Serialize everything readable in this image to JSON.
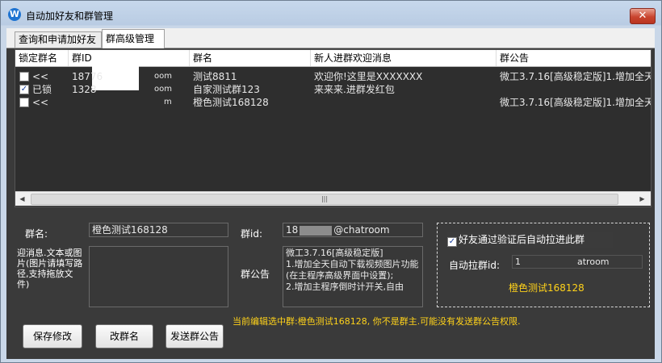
{
  "window": {
    "title": "自动加好友和群管理",
    "icon_letter": "W",
    "close_symbol": "✕"
  },
  "tabs": [
    {
      "label": "查询和申请加好友"
    },
    {
      "label": "群高级管理"
    }
  ],
  "table": {
    "columns": [
      "锁定群名",
      "群ID",
      "群名",
      "新人进群欢迎消息",
      "群公告"
    ],
    "rows": [
      {
        "checked": false,
        "lock": "<<",
        "group_id": "18776",
        "group_id_tail": "oom",
        "group_name": "测试8811",
        "welcome": "欢迎你!这里是XXXXXXX",
        "notice": "微工3.7.16[高级稳定版]1.增加全天"
      },
      {
        "checked": true,
        "lock": "已锁",
        "group_id": "1328",
        "group_id_tail": "oom",
        "group_name": "自家测试群123",
        "welcome": "来来来.进群发红包",
        "notice": ""
      },
      {
        "checked": false,
        "lock": "<<",
        "group_id": "",
        "group_id_tail": "m",
        "group_name": "橙色测试168128",
        "welcome": "",
        "notice": "微工3.7.16[高级稳定版]1.增加全天"
      }
    ],
    "scroll_thumb_grip": "|||"
  },
  "form": {
    "group_name_label": "群名:",
    "group_name_value": "橙色测试168128",
    "welcome_label": "迎消息.文本或图片(图片请填写路径,支持拖放文件)",
    "welcome_value": "",
    "group_id_label": "群id:",
    "group_id_prefix": "18",
    "group_id_suffix": "@chatroom",
    "notice_label": "群公告",
    "notice_value": "微工3.7.16[高级稳定版]\n1.增加全天自动下载视频图片功能(在主程序高级界面中设置);\n2.增加主程序倒时计开关,自由"
  },
  "auto_pull": {
    "checkbox_label": "好友通过验证后自动拉进此群",
    "checked": true,
    "id_label": "自动拉群id:",
    "id_prefix": "1",
    "id_suffix": "atroom",
    "selected_group": "橙色测试168128"
  },
  "status_message": "当前编辑选中群:橙色测试168128, 你不是群主.可能没有发送群公告权限.",
  "buttons": {
    "save": "保存修改",
    "rename": "改群名",
    "send_notice": "发送群公告"
  },
  "colors": {
    "status_yellow": "#ffd21a",
    "panel_dark": "#3a3a3a",
    "title_close_red": "#c9452f"
  }
}
